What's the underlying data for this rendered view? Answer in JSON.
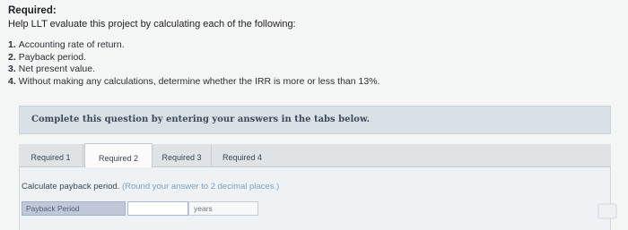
{
  "header": {
    "title": "Required:",
    "intro": "Help LLT evaluate this project by calculating each of the following:"
  },
  "requirements": [
    {
      "num": "1.",
      "text": "Accounting rate of return."
    },
    {
      "num": "2.",
      "text": "Payback period."
    },
    {
      "num": "3.",
      "text": "Net present value."
    },
    {
      "num": "4.",
      "text": "Without making any calculations, determine whether the IRR is more or less than 13%."
    }
  ],
  "banner": {
    "text": "Complete this question by entering your answers in the tabs below."
  },
  "tabs": [
    {
      "label": "Required 1",
      "active": false
    },
    {
      "label": "Required 2",
      "active": true
    },
    {
      "label": "Required 3",
      "active": false
    },
    {
      "label": "Required 4",
      "active": false
    }
  ],
  "panel": {
    "instruction": "Calculate payback period.",
    "hint": "(Round your answer to 2 decimal places.)",
    "row": {
      "label": "Payback Period",
      "value": "",
      "unit": "years"
    }
  }
}
